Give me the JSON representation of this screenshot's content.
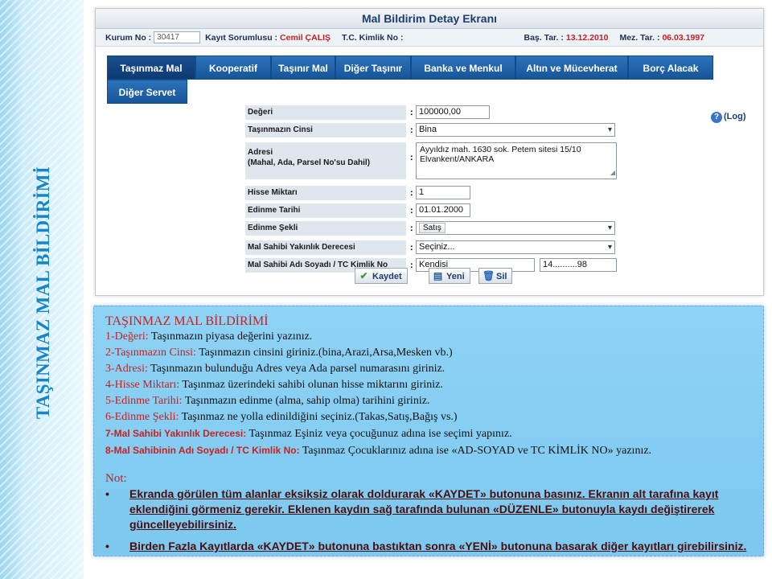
{
  "side_title": "TAŞINMAZ MAL BİLDİRİMİ",
  "screen": {
    "title": "Mal Bildirim Detay Ekranı",
    "info": {
      "kurum_label": "Kurum No :",
      "kurum_value": "30417",
      "kayit_label": "Kayıt Sorumlusu :",
      "kayit_name": "Cemil ÇALIŞ",
      "tc_label": "T.C. Kimlik No :",
      "bas_label": "Baş. Tar. :",
      "bas_value": "13.12.2010",
      "mez_label": "Mez. Tar. :",
      "mez_value": "06.03.1997"
    },
    "tabs": [
      "Taşınmaz Mal",
      "Kooperatif",
      "Taşınır Mal",
      "Diğer Taşınır",
      "Banka ve Menkul",
      "Altın ve Mücevherat",
      "Borç Alacak",
      "Diğer Servet"
    ],
    "active_tab": 0,
    "help_link": "(Log)",
    "form": {
      "degeri_label": "Değeri",
      "degeri_value": "100000,00",
      "cinsi_label": "Taşınmazın Cinsi",
      "cinsi_value": "Bina",
      "adres_label": "Adresi",
      "adres_hint": "(Mahal, Ada, Parsel No'su Dahil)",
      "adres_value": "Ayyıldız mah. 1630 sok. Petem sitesi 15/10 Elvankent/ANKARA",
      "hisse_label": "Hisse Miktarı",
      "hisse_value": "1",
      "edinme_tarihi_label": "Edinme Tarihi",
      "edinme_tarihi_value": "01.01.2000",
      "edinme_sekli_label": "Edinme Şekli",
      "edinme_sekli_value": "Satış",
      "yakinlik_label": "Mal Sahibi Yakınlık Derecesi",
      "yakinlik_value": "Seçiniz...",
      "sahip_label": "Mal Sahibi Adı Soyadı / TC Kimlik No",
      "sahip_name": "Kendisi",
      "sahip_tc": "14..........98",
      "colon": ":"
    },
    "buttons": {
      "save": "Kaydet",
      "new": "Yeni",
      "delete": "Sil"
    }
  },
  "panel": {
    "heading": "TAŞINMAZ MAL BİLDİRİMİ",
    "items": [
      {
        "key": "1-Değeri:",
        "text": " Taşınmazın piyasa değerini yazınız."
      },
      {
        "key": "2-Taşınmazın Cinsi:",
        "text": " Taşınmazın cinsini giriniz.(bina,Arazi,Arsa,Mesken vb.)"
      },
      {
        "key": "3-Adresi:",
        "text": " Taşınmazın bulunduğu Adres veya Ada parsel numarasını giriniz."
      },
      {
        "key": "4-Hisse Miktarı:",
        "text": " Taşınmaz üzerindeki sahibi olunan hisse miktarını giriniz."
      },
      {
        "key": "5-Edinme Tarihi:",
        "text": " Taşınmazın edinme (alma, sahip olma) tarihini giriniz."
      },
      {
        "key": "6-Edinme Şekli:",
        "text": " Taşınmaz ne yolla edinildiğini seçiniz.(Takas,Satış,Bağış vs.)"
      },
      {
        "key": "7-Mal Sahibi Yakınlık Derecesi:",
        "text": " Taşınmaz Eşiniz veya çocuğunuz adına ise seçimi yapınız."
      },
      {
        "key": "8-Mal Sahibinin Adı Soyadı / TC Kimlik No:",
        "text": " Taşınmaz Çocuklarınız adına ise «AD-SOYAD ve TC KİMLİK NO» yazınız."
      }
    ],
    "note_label": "Not:",
    "notes": [
      "Ekranda görülen tüm alanlar eksiksiz olarak doldurarak «KAYDET» butonuna basınız. Ekranın alt tarafına kayıt eklendiğini görmeniz gerekir. Eklenen kaydın sağ tarafında bulunan «DÜZENLE» butonuyla kaydı değiştirerek güncelleyebilirsiniz.",
      "Birden Fazla Kayıtlarda «KAYDET» butonuna bastıktan sonra «YENİ» butonuna basarak diğer kayıtları girebilirsiniz."
    ]
  },
  "colors": {
    "side_title": "#1784c7",
    "tab_bg": "#18549a",
    "panel_bg": "#8fd3f5",
    "panel_key": "#c42223"
  }
}
